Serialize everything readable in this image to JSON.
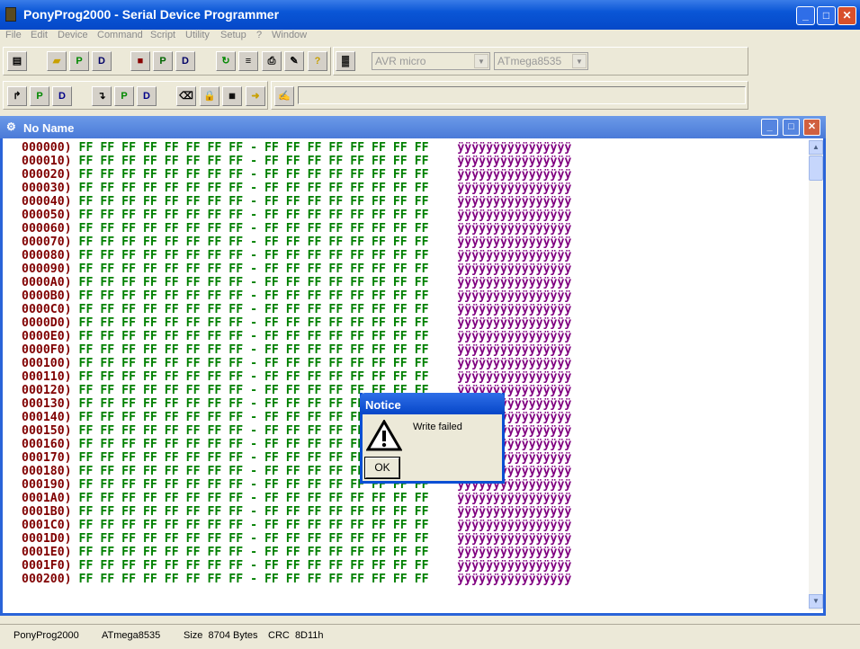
{
  "app": {
    "title": "PonyProg2000 - Serial Device Programmer"
  },
  "menu": [
    "File",
    "Edit",
    "Device",
    "Command",
    "Script",
    "Utility",
    "Setup",
    "?",
    "Window"
  ],
  "toolbar": {
    "family_combo": "AVR micro",
    "device_combo": "ATmega8535"
  },
  "child": {
    "title": "No Name"
  },
  "dialog": {
    "title": "Notice",
    "message": "Write failed",
    "ok_label": "OK"
  },
  "status": {
    "app": "PonyProg2000",
    "device": "ATmega8535",
    "size": "Size  8704 Bytes",
    "crc": "CRC  8D11h"
  },
  "hexdump": {
    "bytes": "FF FF FF FF FF FF FF FF - FF FF FF FF FF FF FF FF",
    "ascii": "ÿÿÿÿÿÿÿÿÿÿÿÿÿÿÿÿ",
    "addresses": [
      "000000)",
      "000010)",
      "000020)",
      "000030)",
      "000040)",
      "000050)",
      "000060)",
      "000070)",
      "000080)",
      "000090)",
      "0000A0)",
      "0000B0)",
      "0000C0)",
      "0000D0)",
      "0000E0)",
      "0000F0)",
      "000100)",
      "000110)",
      "000120)",
      "000130)",
      "000140)",
      "000150)",
      "000160)",
      "000170)",
      "000180)",
      "000190)",
      "0001A0)",
      "0001B0)",
      "0001C0)",
      "0001D0)",
      "0001E0)",
      "0001F0)",
      "000200)"
    ]
  }
}
